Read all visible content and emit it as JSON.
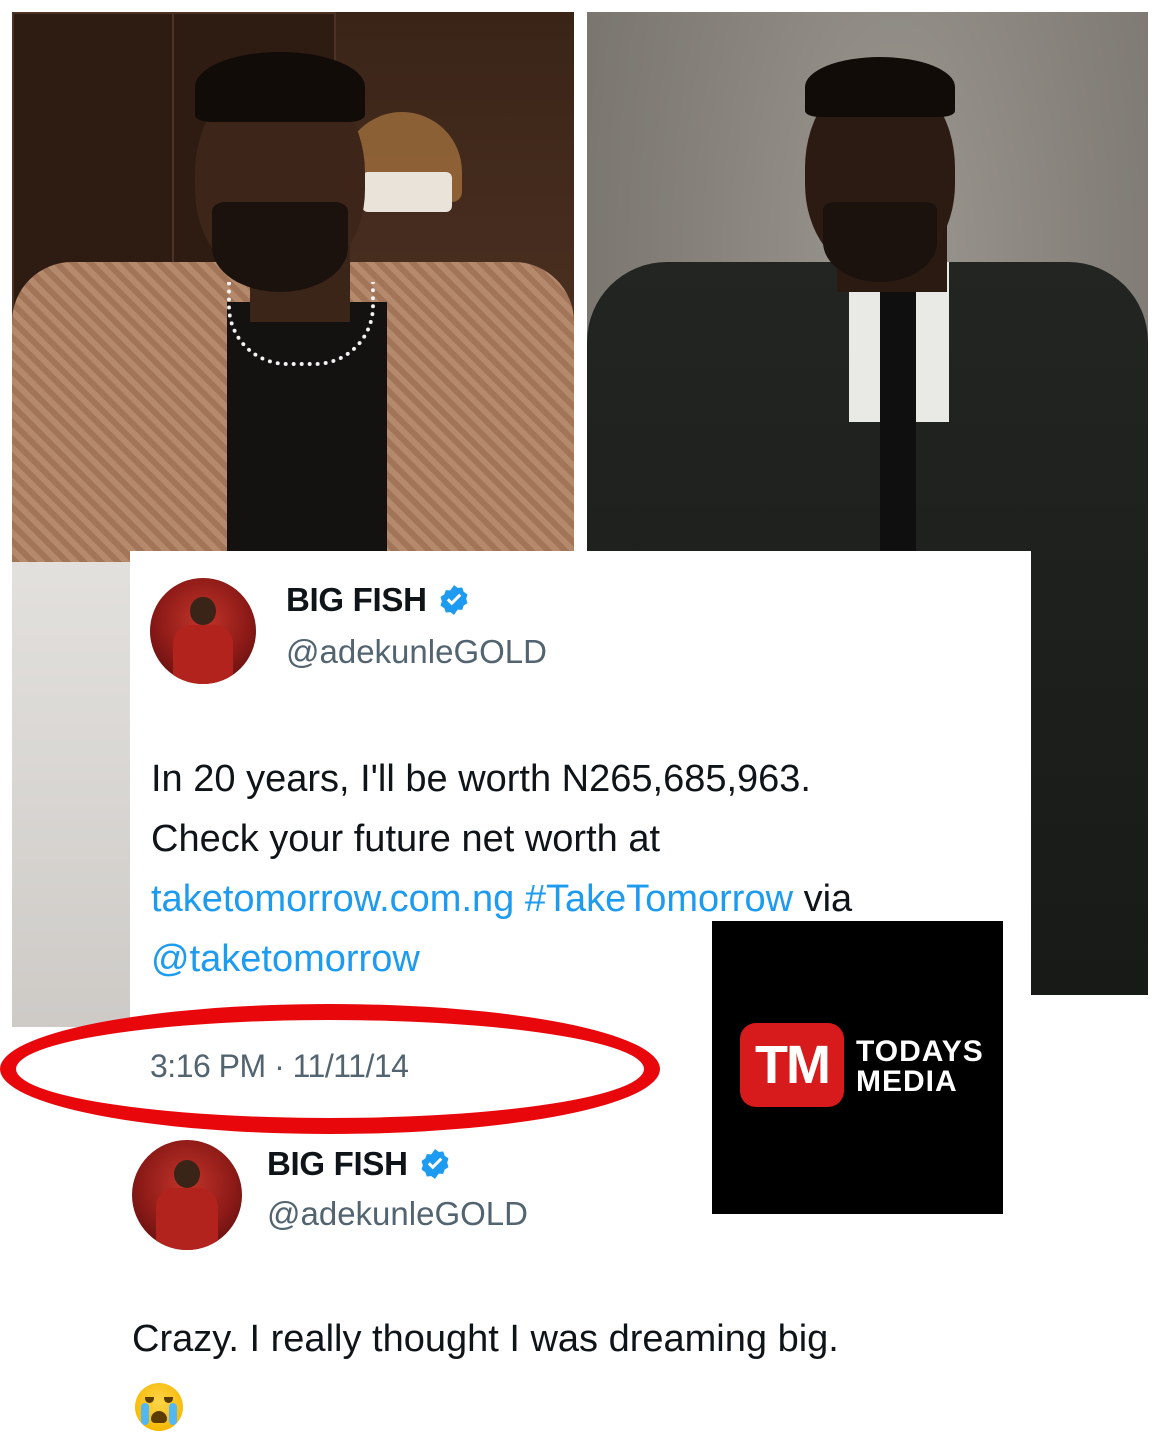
{
  "tweet1": {
    "display_name": "BIG FISH",
    "handle": "@adekunleGOLD",
    "verified": true,
    "text_line1": "In 20 years, I'll be worth N265,685,963.",
    "text_line2": "Check your future net worth at",
    "link_url": "taketomorrow.com.ng",
    "hashtag": "#TakeTomorrow",
    "via_word": "via",
    "mention": "@taketomorrow",
    "timestamp": "3:16 PM · 11/11/14"
  },
  "tweet2": {
    "display_name": "BIG FISH",
    "handle": "@adekunleGOLD",
    "verified": true,
    "text": "Crazy. I really thought I was dreaming big.",
    "emoji": "loudly-crying-face"
  },
  "watermark": {
    "badge": "TM",
    "line1": "TODAYS",
    "line2": "MEDIA"
  },
  "colors": {
    "link": "#1d9bf0",
    "verified": "#1d9bf0",
    "annotation_red": "#e8070b",
    "logo_red": "#d71a1b"
  }
}
